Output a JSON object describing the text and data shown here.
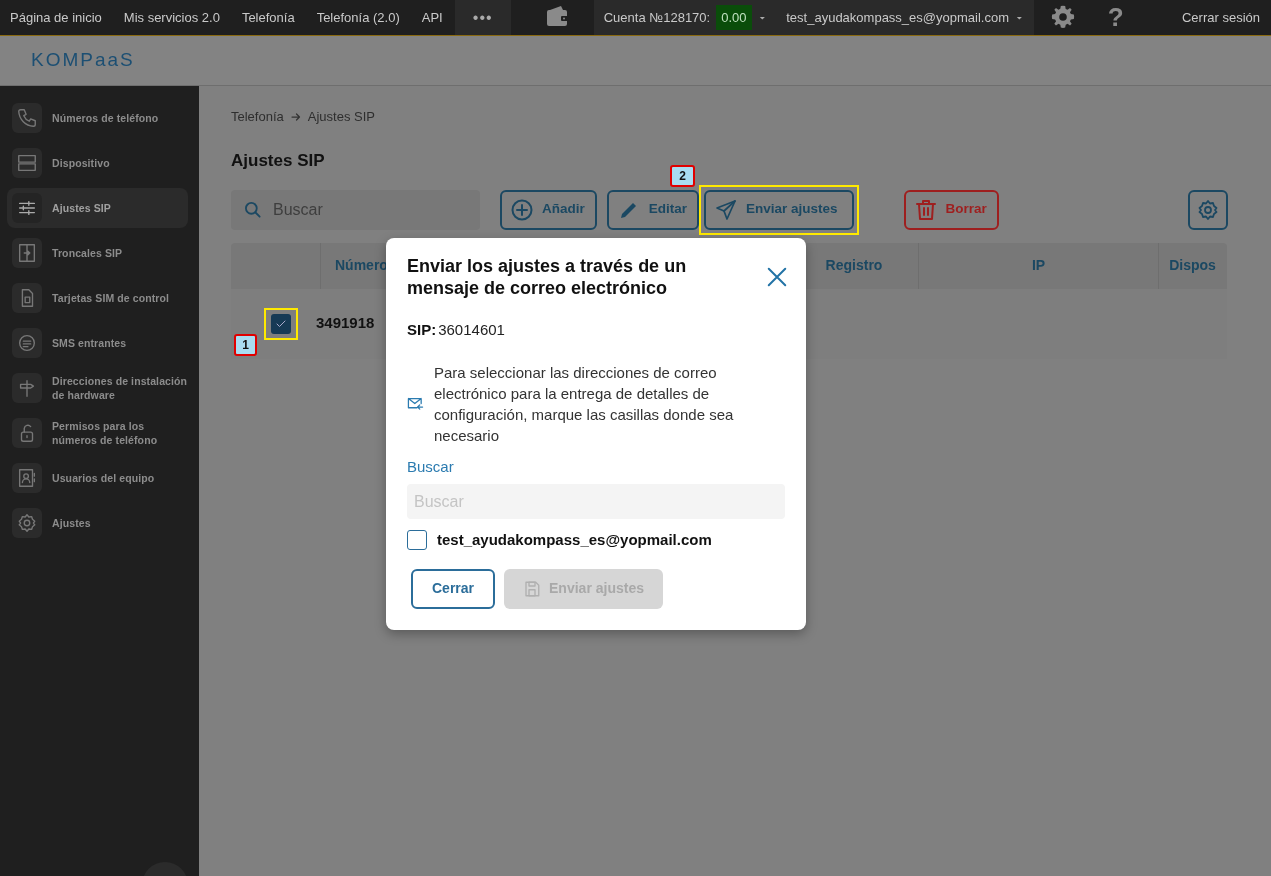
{
  "top_nav": {
    "links": [
      {
        "label": "Página de inicio"
      },
      {
        "label": "Mis servicios 2.0"
      },
      {
        "label": "Telefonía"
      },
      {
        "label": "Telefonía (2.0)"
      },
      {
        "label": "API"
      }
    ],
    "more": "•••",
    "account_label": "Cuenta №128170:",
    "balance": "0.00",
    "user_email": "test_ayudakompass_es@yopmail.com",
    "help": "?",
    "logout": "Cerrar sesión"
  },
  "brand": "KOMPaaS",
  "sidebar": {
    "items": [
      {
        "label": "Números de teléfono",
        "selected": false
      },
      {
        "label": "Dispositivo",
        "selected": false
      },
      {
        "label": "Ajustes SIP",
        "selected": true
      },
      {
        "label": "Troncales SIP",
        "selected": false
      },
      {
        "label": "Tarjetas SIM de control",
        "selected": false
      },
      {
        "label": "SMS entrantes",
        "selected": false
      },
      {
        "label": "Direcciones de instalación de hardware",
        "selected": false
      },
      {
        "label": "Permisos para los números de teléfono",
        "selected": false
      },
      {
        "label": "Usuarios del equipo",
        "selected": false
      },
      {
        "label": "Ajustes",
        "selected": false
      }
    ]
  },
  "breadcrumb": [
    "Telefonía",
    "Ajustes SIP"
  ],
  "page_title": "Ajustes SIP",
  "search": {
    "placeholder": "Buscar"
  },
  "toolbar": [
    {
      "kind": "add",
      "label": "Añadir"
    },
    {
      "kind": "edit",
      "label": "Editar"
    },
    {
      "kind": "send",
      "label": "Enviar ajustes",
      "callout": "2"
    },
    {
      "kind": "delete",
      "label": "Borrar"
    },
    {
      "kind": "settings"
    }
  ],
  "table": {
    "columns": [
      "Número",
      "Registro",
      "IP",
      "Dispos"
    ],
    "rows": [
      {
        "selected": true,
        "callout": "1",
        "cells": [
          "3491918"
        ]
      }
    ]
  },
  "modal": {
    "title": "Enviar los ajustes a través de un mensaje de correo electrónico",
    "sip_label": "SIP:",
    "sip_value": "36014601",
    "hint": "Para seleccionar las direcciones de correo electrónico para la entrega de detalles de configuración, marque las casillas donde sea necesario",
    "search_label": "Buscar",
    "search_placeholder": "Buscar",
    "emails": [
      {
        "address": "test_ayudakompass_es@yopmail.com",
        "checked": false
      }
    ],
    "buttons": [
      {
        "kind": "close",
        "label": "Cerrar",
        "disabled": false
      },
      {
        "kind": "send",
        "label": "Enviar ajustes",
        "disabled": true
      }
    ]
  }
}
